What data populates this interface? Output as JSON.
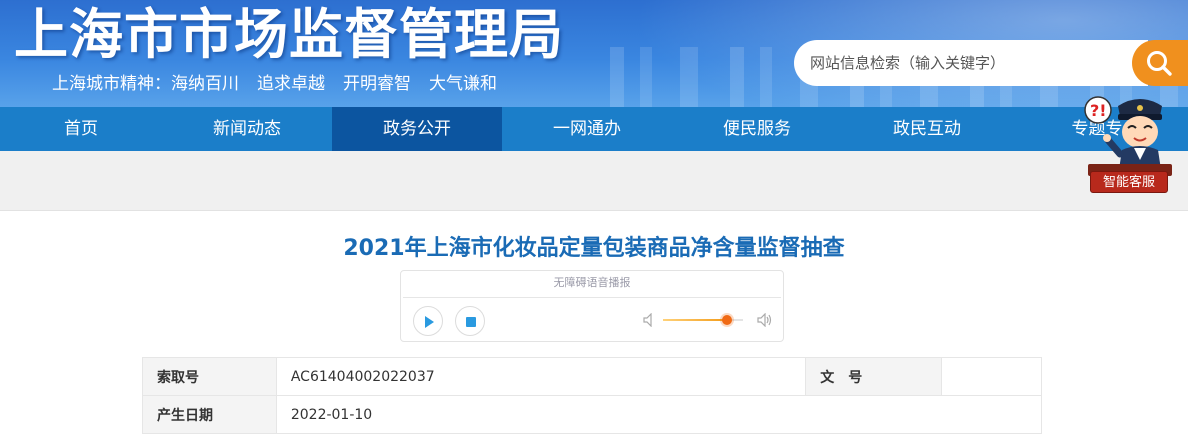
{
  "header": {
    "site_title": "上海市市场监督管理局",
    "motto": [
      "上海城市精神：海纳百川",
      "追求卓越",
      "开明睿智",
      "大气谦和"
    ],
    "search_placeholder": "网站信息检索（输入关键字）"
  },
  "nav": {
    "items": [
      {
        "label": "首页",
        "active": false
      },
      {
        "label": "新闻动态",
        "active": false
      },
      {
        "label": "政务公开",
        "active": true
      },
      {
        "label": "一网通办",
        "active": false
      },
      {
        "label": "便民服务",
        "active": false
      },
      {
        "label": "政民互动",
        "active": false
      },
      {
        "label": "专题专",
        "active": false
      }
    ]
  },
  "assistant": {
    "label": "智能客服"
  },
  "article": {
    "title": "2021年上海市化妆品定量包装商品净含量监督抽查"
  },
  "player": {
    "caption": "无障碍语音播报",
    "volume": 0.8
  },
  "info": {
    "rows": [
      {
        "k1": "索取号",
        "v1": "AC61404002022037",
        "k2": "文　号",
        "v2": ""
      },
      {
        "k1": "产生日期",
        "v1": "2022-01-10"
      }
    ]
  },
  "colors": {
    "nav_bg": "#1b7ec9",
    "nav_active": "#0c55a0",
    "search_button": "#f0901e",
    "title_blue": "#1a6bb5"
  }
}
